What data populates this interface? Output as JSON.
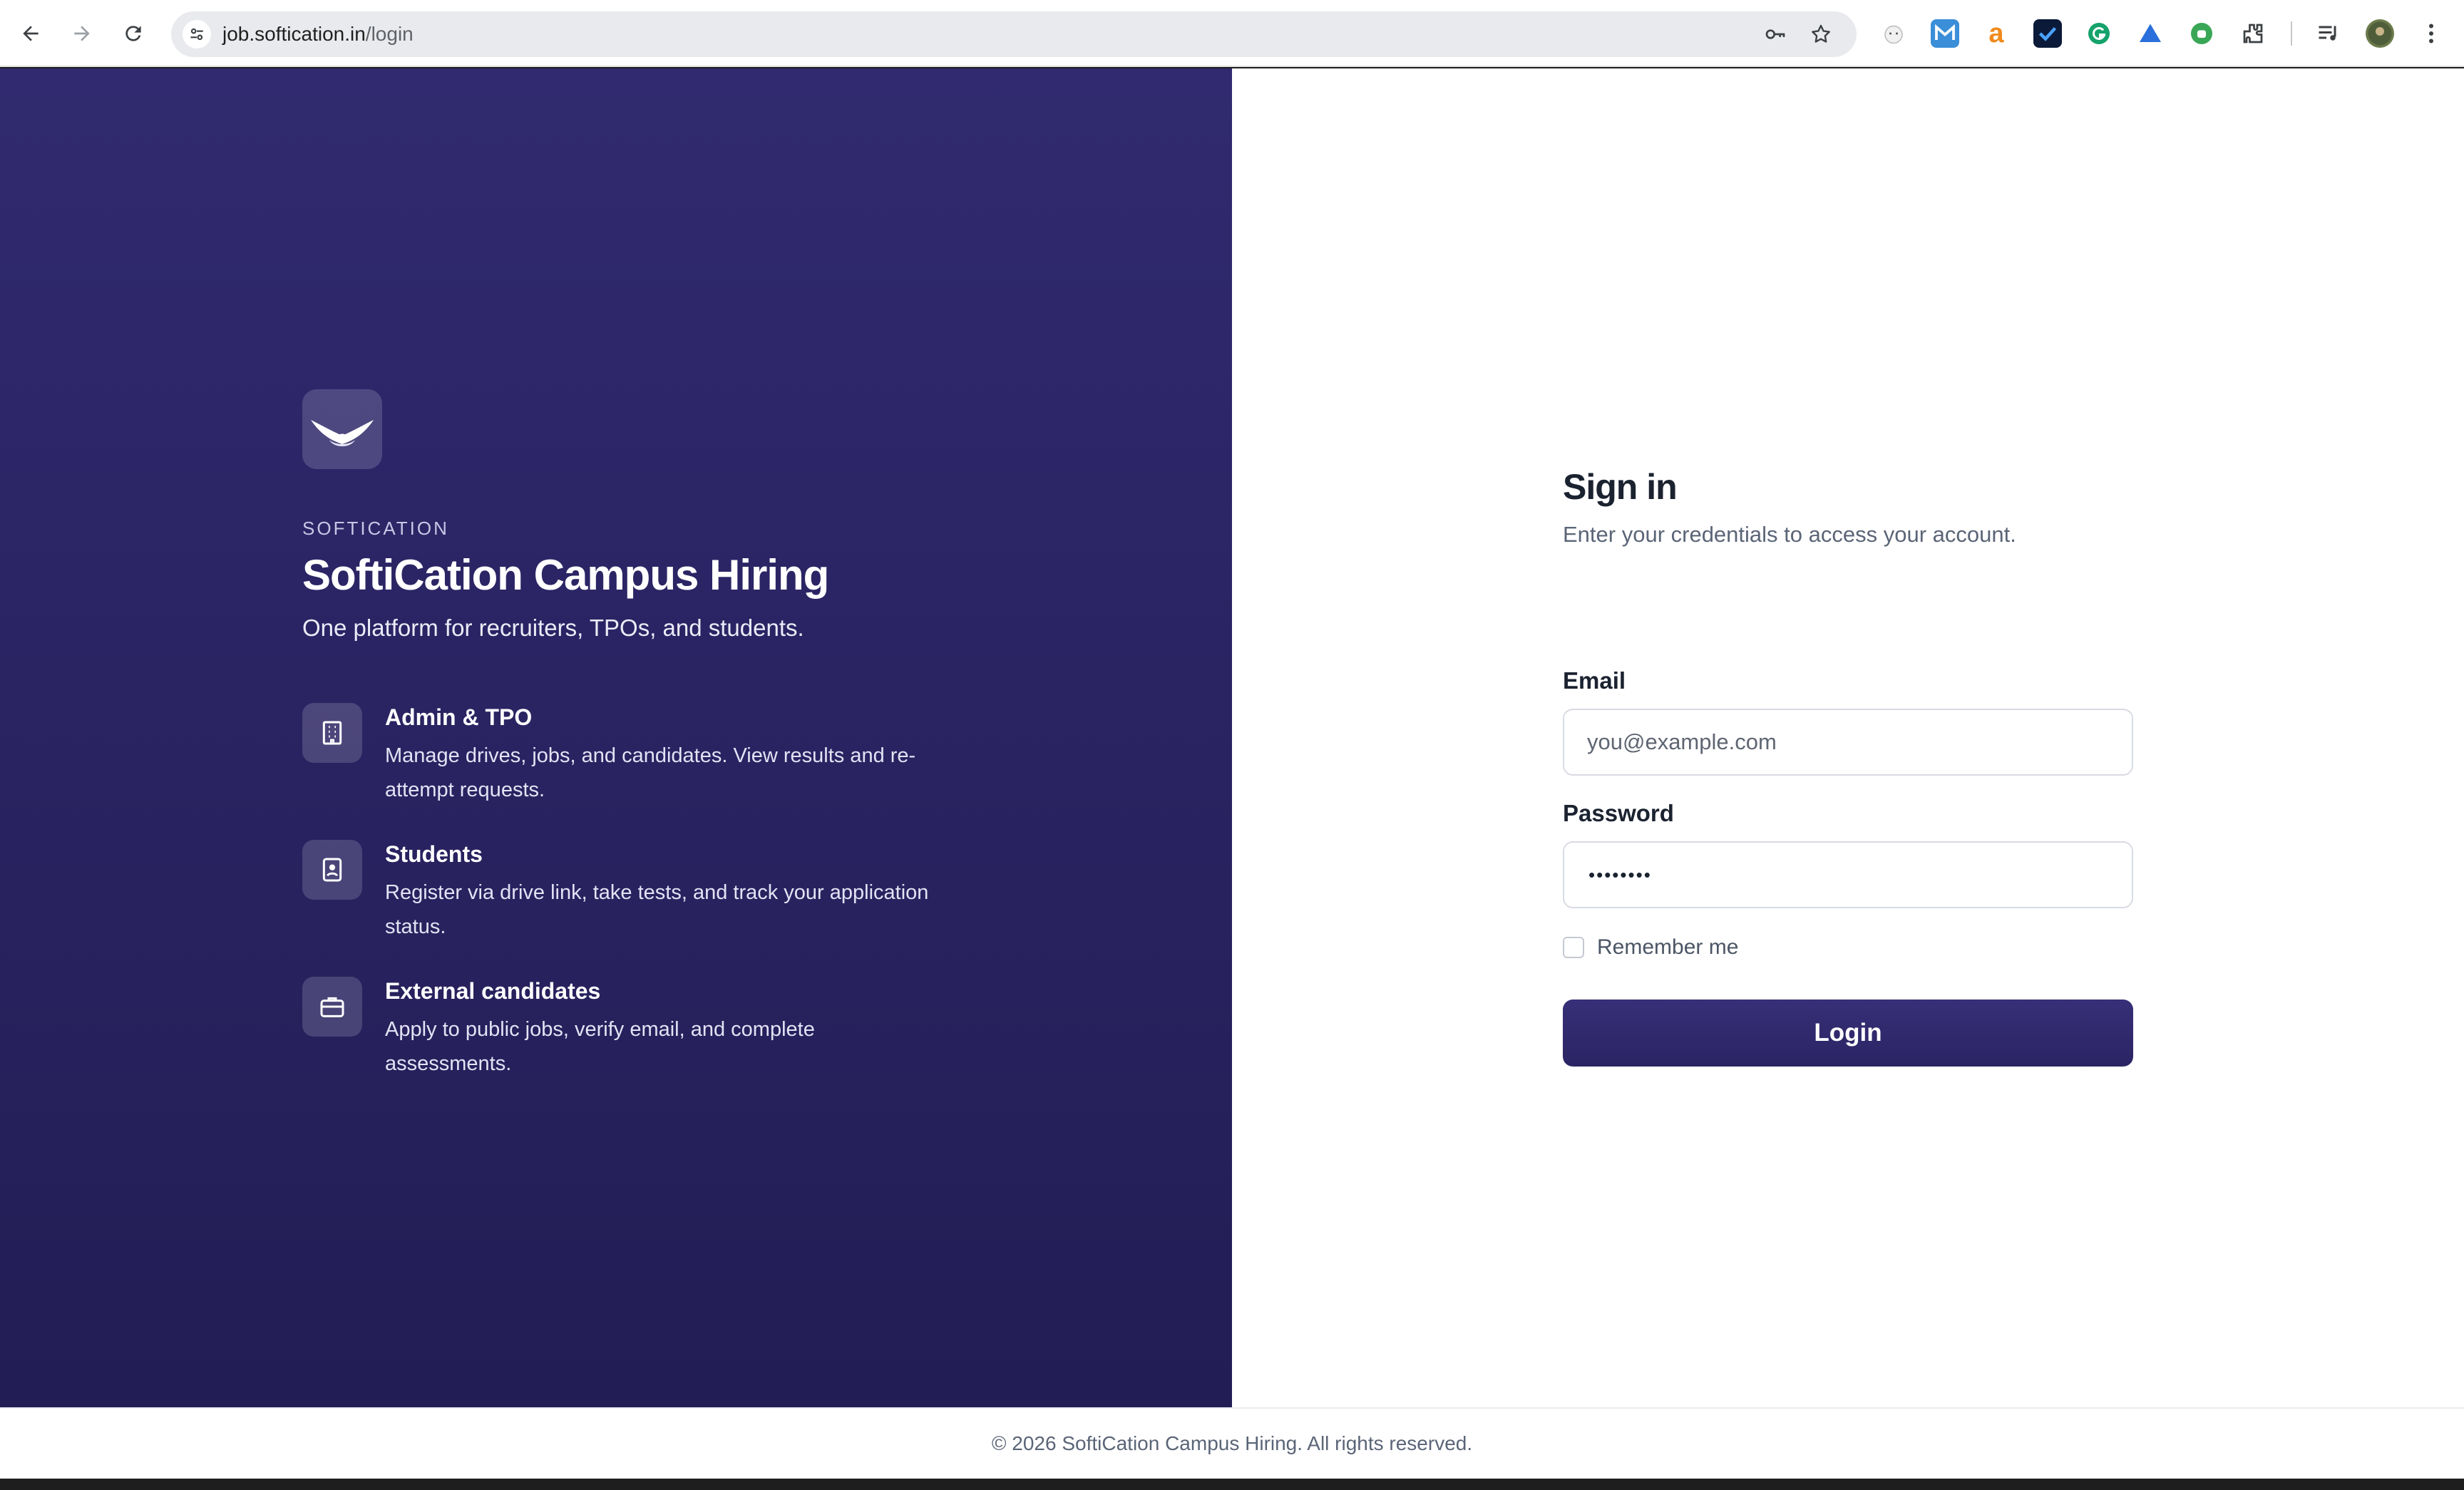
{
  "browser": {
    "url_host": "job.softication.in",
    "url_path": "/login",
    "extensions": [
      "cat-extension-icon",
      "m-extension-icon",
      "amazon-extension-icon",
      "checkmark-extension-icon",
      "grammarly-extension-icon",
      "drive-extension-icon",
      "android-extension-icon",
      "puzzle-extensions-icon",
      "media-controls-icon",
      "profile-avatar-icon",
      "menu-dots-icon"
    ]
  },
  "brand": {
    "eyebrow": "SOFTICATION",
    "title": "SoftiCation Campus Hiring",
    "subtitle": "One platform for recruiters, TPOs, and students."
  },
  "features": [
    {
      "title": "Admin & TPO",
      "desc": "Manage drives, jobs, and candidates. View results and re-attempt requests.",
      "icon": "building-icon"
    },
    {
      "title": "Students",
      "desc": "Register via drive link, take tests, and track your application status.",
      "icon": "id-badge-icon"
    },
    {
      "title": "External candidates",
      "desc": "Apply to public jobs, verify email, and complete assessments.",
      "icon": "briefcase-icon"
    }
  ],
  "form": {
    "title": "Sign in",
    "subtitle": "Enter your credentials to access your account.",
    "email_label": "Email",
    "email_placeholder": "you@example.com",
    "password_label": "Password",
    "password_value": "••••••••",
    "remember_label": "Remember me",
    "remember_checked": false,
    "login_label": "Login"
  },
  "footer": {
    "text": "© 2026 SoftiCation Campus Hiring. All rights reserved."
  },
  "colors": {
    "panel_top": "#312a70",
    "panel_bottom": "#231d55",
    "button": "#2b2463"
  }
}
